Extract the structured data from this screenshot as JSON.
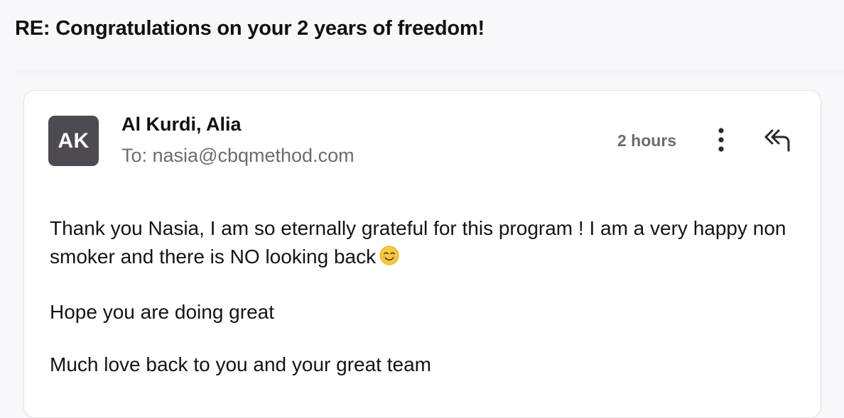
{
  "email": {
    "subject": "RE: Congratulations on your 2 years of freedom!",
    "sender": {
      "initials": "AK",
      "name": "Al Kurdi, Alia",
      "to": "To: nasia@cbqmethod.com"
    },
    "time": "2 hours",
    "actions": {
      "more_icon": "more-vertical-icon",
      "reply_icon": "reply-all-icon"
    },
    "body": {
      "paragraph1": "Thank you Nasia, I am so eternally grateful for this program ! I am a very happy non smoker and there is NO looking back",
      "emoji": "smiling-face-icon",
      "paragraph2": "Hope you are doing great",
      "paragraph3": "Much love back to you and your great team"
    }
  }
}
